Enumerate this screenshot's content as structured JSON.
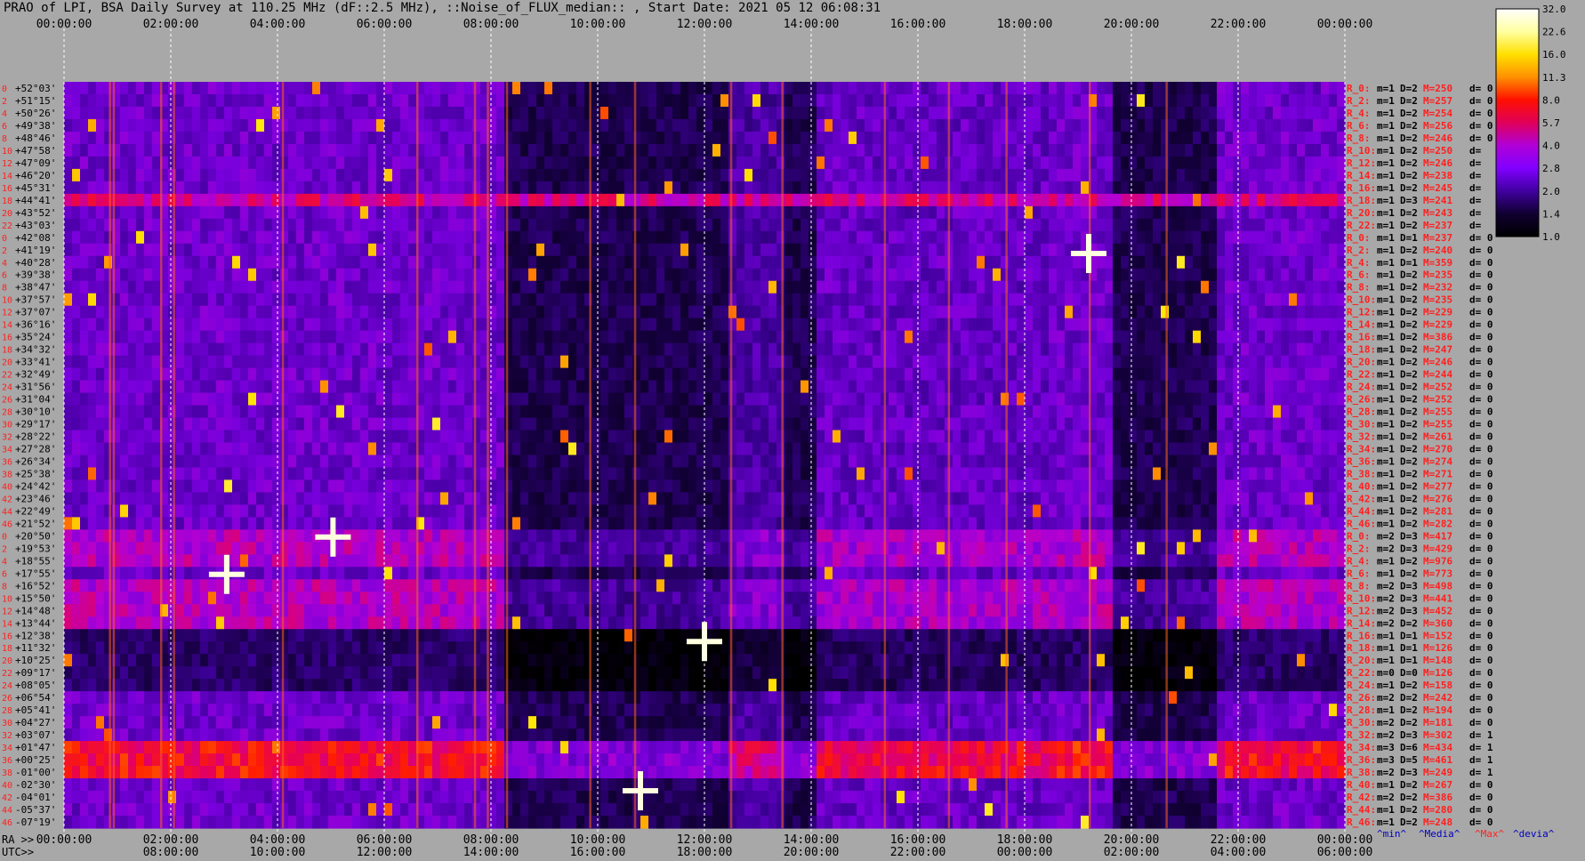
{
  "title": "PRAO of LPI, BSA Daily Survey at 110.25 MHz (dF::2.5 MHz), ::Noise_of_FLUX_median:: , Start Date: 2021 05 12 06:08:31",
  "chart_data": {
    "type": "heatmap",
    "x_axis_top": {
      "label": "",
      "ticks": [
        "00:00:00",
        "02:00:00",
        "04:00:00",
        "06:00:00",
        "08:00:00",
        "10:00:00",
        "12:00:00",
        "14:00:00",
        "16:00:00",
        "18:00:00",
        "20:00:00",
        "22:00:00",
        "00:00:00"
      ]
    },
    "x_axis_bottom_ra": {
      "label": "RA >>",
      "ticks": [
        "00:00:00",
        "02:00:00",
        "04:00:00",
        "06:00:00",
        "08:00:00",
        "10:00:00",
        "12:00:00",
        "14:00:00",
        "16:00:00",
        "18:00:00",
        "20:00:00",
        "22:00:00",
        "00:00:00"
      ]
    },
    "x_axis_bottom_utc": {
      "label": "UTC>>",
      "ticks": [
        "08:00:00",
        "10:00:00",
        "12:00:00",
        "14:00:00",
        "16:00:00",
        "18:00:00",
        "20:00:00",
        "22:00:00",
        "00:00:00",
        "02:00:00",
        "04:00:00",
        "06:00:00"
      ]
    },
    "y_labels": [
      "+52°03'",
      "+51°15'",
      "+50°26'",
      "+49°38'",
      "+48°46'",
      "+47°58'",
      "+47°09'",
      "+46°20'",
      "+45°31'",
      "+44°41'",
      "+43°52'",
      "+43°03'",
      "+42°08'",
      "+41°19'",
      "+40°28'",
      "+39°38'",
      "+38°47'",
      "+37°57'",
      "+37°07'",
      "+36°16'",
      "+35°24'",
      "+34°32'",
      "+33°41'",
      "+32°49'",
      "+31°56'",
      "+31°04'",
      "+30°10'",
      "+29°17'",
      "+28°22'",
      "+27°28'",
      "+26°34'",
      "+25°38'",
      "+24°42'",
      "+23°46'",
      "+22°49'",
      "+21°52'",
      "+20°50'",
      "+19°53'",
      "+18°55'",
      "+17°55'",
      "+16°52'",
      "+15°50'",
      "+14°48'",
      "+13°44'",
      "+12°38'",
      "+11°32'",
      "+10°25'",
      "+09°17'",
      "+08°05'",
      "+06°54'",
      "+05°41'",
      "+04°27'",
      "+03°07'",
      "+01°47'",
      "+00°25'",
      "-01°00'",
      "-02°30'",
      "-04°01'",
      "-05°37'",
      "-07°19'"
    ],
    "row_index_labels": [
      "0",
      "2",
      "4",
      "6",
      "8",
      "10",
      "12",
      "14",
      "16",
      "18",
      "20",
      "22",
      "0",
      "2",
      "4",
      "6",
      "8",
      "10",
      "12",
      "14",
      "16",
      "18",
      "20",
      "22",
      "24",
      "26",
      "28",
      "30",
      "32",
      "34",
      "36",
      "38",
      "40",
      "42",
      "44",
      "46",
      "0",
      "2",
      "4",
      "6",
      "8",
      "10",
      "12",
      "14",
      "16",
      "18",
      "20",
      "22",
      "24",
      "26",
      "28",
      "30",
      "32",
      "34",
      "36",
      "38",
      "40",
      "42",
      "44",
      "46"
    ],
    "right_stats": [
      [
        "R_0:",
        "m=1",
        "D=2",
        "M=250",
        "d= 0"
      ],
      [
        "R_2:",
        "m=1",
        "D=2",
        "M=257",
        "d= 0"
      ],
      [
        "R_4:",
        "m=1",
        "D=2",
        "M=254",
        "d= 0"
      ],
      [
        "R_6:",
        "m=1",
        "D=2",
        "M=256",
        "d= 0"
      ],
      [
        "R_8:",
        "m=1",
        "D=2",
        "M=246",
        "d= 0"
      ],
      [
        "R_10:",
        "m=1",
        "D=2",
        "M=250",
        "d="
      ],
      [
        "R_12:",
        "m=1",
        "D=2",
        "M=246",
        "d="
      ],
      [
        "R_14:",
        "m=1",
        "D=2",
        "M=238",
        "d="
      ],
      [
        "R_16:",
        "m=1",
        "D=2",
        "M=245",
        "d="
      ],
      [
        "R_18:",
        "m=1",
        "D=3",
        "M=241",
        "d="
      ],
      [
        "R_20:",
        "m=1",
        "D=2",
        "M=243",
        "d="
      ],
      [
        "R_22:",
        "m=1",
        "D=2",
        "M=237",
        "d="
      ],
      [
        "R_0:",
        "m=1",
        "D=1",
        "M=237",
        "d= 0"
      ],
      [
        "R_2:",
        "m=1",
        "D=2",
        "M=240",
        "d= 0"
      ],
      [
        "R_4:",
        "m=1",
        "D=1",
        "M=359",
        "d= 0"
      ],
      [
        "R_6:",
        "m=1",
        "D=2",
        "M=235",
        "d= 0"
      ],
      [
        "R_8:",
        "m=1",
        "D=2",
        "M=232",
        "d= 0"
      ],
      [
        "R_10:",
        "m=1",
        "D=2",
        "M=235",
        "d= 0"
      ],
      [
        "R_12:",
        "m=1",
        "D=2",
        "M=229",
        "d= 0"
      ],
      [
        "R_14:",
        "m=1",
        "D=2",
        "M=229",
        "d= 0"
      ],
      [
        "R_16:",
        "m=1",
        "D=2",
        "M=386",
        "d= 0"
      ],
      [
        "R_18:",
        "m=1",
        "D=2",
        "M=247",
        "d= 0"
      ],
      [
        "R_20:",
        "m=1",
        "D=2",
        "M=246",
        "d= 0"
      ],
      [
        "R_22:",
        "m=1",
        "D=2",
        "M=244",
        "d= 0"
      ],
      [
        "R_24:",
        "m=1",
        "D=2",
        "M=252",
        "d= 0"
      ],
      [
        "R_26:",
        "m=1",
        "D=2",
        "M=252",
        "d= 0"
      ],
      [
        "R_28:",
        "m=1",
        "D=2",
        "M=255",
        "d= 0"
      ],
      [
        "R_30:",
        "m=1",
        "D=2",
        "M=255",
        "d= 0"
      ],
      [
        "R_32:",
        "m=1",
        "D=2",
        "M=261",
        "d= 0"
      ],
      [
        "R_34:",
        "m=1",
        "D=2",
        "M=270",
        "d= 0"
      ],
      [
        "R_36:",
        "m=1",
        "D=2",
        "M=274",
        "d= 0"
      ],
      [
        "R_38:",
        "m=1",
        "D=2",
        "M=271",
        "d= 0"
      ],
      [
        "R_40:",
        "m=1",
        "D=2",
        "M=277",
        "d= 0"
      ],
      [
        "R_42:",
        "m=1",
        "D=2",
        "M=276",
        "d= 0"
      ],
      [
        "R_44:",
        "m=1",
        "D=2",
        "M=281",
        "d= 0"
      ],
      [
        "R_46:",
        "m=1",
        "D=2",
        "M=282",
        "d= 0"
      ],
      [
        "R_0:",
        "m=2",
        "D=3",
        "M=417",
        "d= 0"
      ],
      [
        "R_2:",
        "m=2",
        "D=3",
        "M=429",
        "d= 0"
      ],
      [
        "R_4:",
        "m=1",
        "D=2",
        "M=976",
        "d= 0"
      ],
      [
        "R_6:",
        "m=1",
        "D=2",
        "M=773",
        "d= 0"
      ],
      [
        "R_8:",
        "m=2",
        "D=3",
        "M=498",
        "d= 0"
      ],
      [
        "R_10:",
        "m=2",
        "D=3",
        "M=441",
        "d= 0"
      ],
      [
        "R_12:",
        "m=2",
        "D=3",
        "M=452",
        "d= 0"
      ],
      [
        "R_14:",
        "m=2",
        "D=2",
        "M=360",
        "d= 0"
      ],
      [
        "R_16:",
        "m=1",
        "D=1",
        "M=152",
        "d= 0"
      ],
      [
        "R_18:",
        "m=1",
        "D=1",
        "M=126",
        "d= 0"
      ],
      [
        "R_20:",
        "m=1",
        "D=1",
        "M=148",
        "d= 0"
      ],
      [
        "R_22:",
        "m=0",
        "D=0",
        "M=126",
        "d= 0"
      ],
      [
        "R_24:",
        "m=1",
        "D=2",
        "M=158",
        "d= 0"
      ],
      [
        "R_26:",
        "m=2",
        "D=2",
        "M=242",
        "d= 0"
      ],
      [
        "R_28:",
        "m=1",
        "D=2",
        "M=194",
        "d= 0"
      ],
      [
        "R_30:",
        "m=2",
        "D=2",
        "M=181",
        "d= 0"
      ],
      [
        "R_32:",
        "m=2",
        "D=3",
        "M=302",
        "d= 1"
      ],
      [
        "R_34:",
        "m=3",
        "D=6",
        "M=434",
        "d= 1"
      ],
      [
        "R_36:",
        "m=3",
        "D=5",
        "M=461",
        "d= 1"
      ],
      [
        "R_38:",
        "m=2",
        "D=3",
        "M=249",
        "d= 1"
      ],
      [
        "R_40:",
        "m=1",
        "D=2",
        "M=267",
        "d= 0"
      ],
      [
        "R_42:",
        "m=2",
        "D=2",
        "M=386",
        "d= 0"
      ],
      [
        "R_44:",
        "m=1",
        "D=2",
        "M=280",
        "d= 0"
      ],
      [
        "R_46:",
        "m=1",
        "D=2",
        "M=248",
        "d= 0"
      ]
    ],
    "stats_legend": [
      "^min^",
      "^Media^",
      "^Max^",
      "^devia^"
    ],
    "colorbar": {
      "ticks": [
        "32.0",
        "22.6",
        "16.0",
        "11.3",
        "8.0",
        "5.7",
        "4.0",
        "2.8",
        "2.0",
        "1.4",
        "1.0"
      ],
      "colors": [
        "#ffffff",
        "#ffffa0",
        "#ffe000",
        "#ff9000",
        "#ff1000",
        "#e0005a",
        "#b000d8",
        "#8000ff",
        "#4000a0",
        "#100030",
        "#000000"
      ]
    },
    "background": {
      "day_columns": [
        [
          0,
          0.345
        ],
        [
          0.77,
          0.82
        ],
        [
          0.9,
          1
        ]
      ],
      "night_columns": [
        [
          0.345,
          0.52
        ],
        [
          0.52,
          0.59
        ],
        [
          0.82,
          0.9
        ]
      ],
      "bright_vertical_x": [
        0.035,
        0.038,
        0.075,
        0.085,
        0.17,
        0.275,
        0.32,
        0.33,
        0.345,
        0.41,
        0.445,
        0.52,
        0.56,
        0.64,
        0.69,
        0.735,
        0.8,
        0.86
      ],
      "horizontal_bright_row": 9,
      "hot_rows": [
        53,
        54,
        55
      ],
      "warm_rows": [
        36,
        37,
        38,
        40,
        41,
        42,
        43
      ],
      "cold_rows": [
        44,
        45,
        46,
        47,
        48
      ]
    }
  }
}
